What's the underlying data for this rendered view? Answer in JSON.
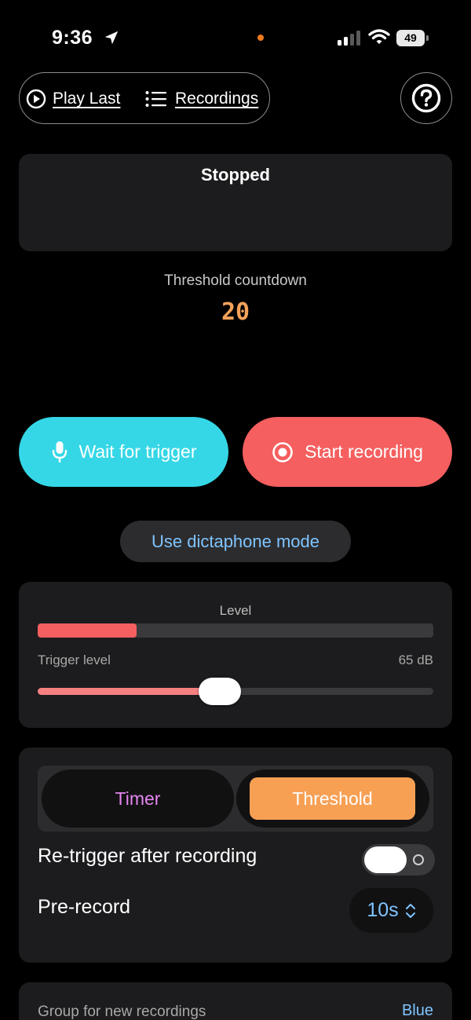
{
  "status_bar": {
    "time": "9:36",
    "battery": "49"
  },
  "nav": {
    "play_last": "Play Last",
    "recordings": "Recordings"
  },
  "status": {
    "title": "Stopped"
  },
  "countdown": {
    "label": "Threshold countdown",
    "value": "20"
  },
  "buttons": {
    "wait_for_trigger": "Wait for trigger",
    "start_recording": "Start recording",
    "dictaphone": "Use dictaphone mode"
  },
  "level": {
    "label": "Level",
    "level_fraction": 0.25,
    "trigger_label": "Trigger level",
    "trigger_value": "65 dB",
    "trigger_fraction": 0.46
  },
  "mode": {
    "timer": "Timer",
    "threshold": "Threshold",
    "selected": "threshold"
  },
  "settings": {
    "retrigger_label": "Re-trigger after recording",
    "retrigger_on": false,
    "prerecord_label": "Pre-record",
    "prerecord_value": "10s"
  },
  "group": {
    "label": "Group for new recordings",
    "value": "Blue"
  },
  "colors": {
    "accent_cyan": "#35d7e6",
    "accent_red": "#f55f5f",
    "accent_orange": "#f7a054",
    "link_blue": "#7fc4ff",
    "timer_pink": "#e685f0"
  },
  "icons": {
    "location": "location-arrow-icon",
    "play": "play-circle-icon",
    "list": "list-icon",
    "help": "question-circle-icon",
    "mic": "microphone-icon",
    "record": "record-circle-icon",
    "updown": "chevron-up-down-icon"
  }
}
